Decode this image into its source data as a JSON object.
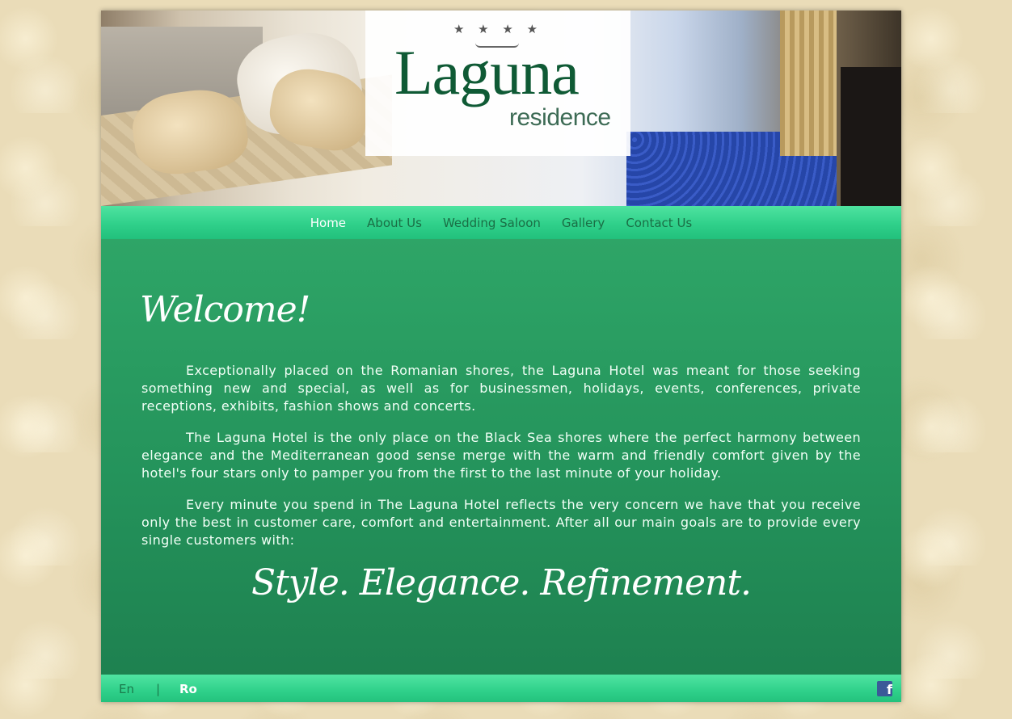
{
  "header": {
    "logo_main": "Laguna",
    "logo_sub": "residence",
    "logo_stars": "★ ★ ★ ★"
  },
  "nav": {
    "items": [
      {
        "label": "Home",
        "active": true
      },
      {
        "label": "About Us"
      },
      {
        "label": "Wedding Saloon"
      },
      {
        "label": "Gallery"
      },
      {
        "label": "Contact Us"
      }
    ]
  },
  "main": {
    "welcome": "Welcome!",
    "paragraphs": [
      "Exceptionally placed on the Romanian shores, the Laguna Hotel was meant for those seeking something new and special, as well as for businessmen, holidays, events, conferences, private receptions, exhibits, fashion shows and concerts.",
      "The Laguna Hotel is the only place on the Black Sea shores where the perfect harmony between elegance and the Mediterranean good sense merge with the warm and friendly comfort given by the hotel's four stars only to pamper you from the first to the last minute of your holiday.",
      "Every minute you spend in The Laguna Hotel reflects the very concern we have that you receive only the best in customer care, comfort and entertainment. After all our main goals are to provide every single customers with:"
    ],
    "motto": "Style. Elegance. Refinement."
  },
  "footer": {
    "lang_en": "En",
    "lang_sep": "|",
    "lang_ro": "Ro",
    "facebook_glyph": "f"
  },
  "colors": {
    "nav_active": "#ffffff",
    "nav_inactive": "#1a6e45",
    "content_green": "#24935b",
    "facebook_blue": "#3b5998"
  },
  "icons": [
    "facebook-icon"
  ]
}
